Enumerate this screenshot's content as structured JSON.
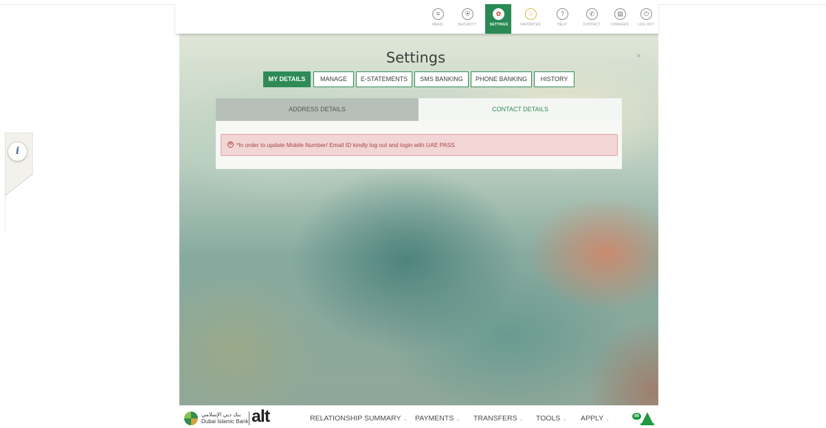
{
  "toolbar": {
    "items": [
      {
        "label": "MENU",
        "icon": "menu-icon",
        "glyph": "≡"
      },
      {
        "label": "SECURITY",
        "icon": "security-icon",
        "glyph": "⛨"
      },
      {
        "label": "SETTINGS",
        "icon": "settings-icon",
        "glyph": "✿"
      },
      {
        "label": "FAVORITES",
        "icon": "star-icon",
        "glyph": "☆"
      },
      {
        "label": "HELP",
        "icon": "help-icon",
        "glyph": "?"
      },
      {
        "label": "CONTACT",
        "icon": "phone-icon",
        "glyph": "✆"
      },
      {
        "label": "CHARGES",
        "icon": "charges-icon",
        "glyph": "▤"
      },
      {
        "label": "LOG OUT",
        "icon": "power-icon",
        "glyph": "⏻"
      }
    ],
    "active": "SETTINGS",
    "active_color": "#2a8a55"
  },
  "modal": {
    "title": "Settings",
    "close": "×",
    "tabs": [
      "MY DETAILS",
      "MANAGE",
      "E-STATEMENTS",
      "SMS BANKING",
      "PHONE BANKING",
      "HISTORY"
    ],
    "active_tab": "MY DETAILS",
    "subtabs": [
      "ADDRESS DETAILS",
      "CONTACT DETAILS"
    ],
    "active_subtab": "CONTACT DETAILS",
    "alert_icon": "⊗",
    "alert_text": "*In order to update Mobile Number/ Email ID kindly log out and login with UAE PASS"
  },
  "info_button": "i",
  "bottom_nav": {
    "logo_arabic": "بنك دبي الإسلامي",
    "logo_english": "Dubai Islamic Bank",
    "logo_brand": "alt",
    "items": [
      "RELATIONSHIP SUMMARY",
      "PAYMENTS",
      "TRANSFERS",
      "TOOLS",
      "APPLY"
    ],
    "caret": "⌄",
    "notification_badge": "00"
  },
  "colors": {
    "brand_green": "#2e8b57",
    "alert_bg": "#f2d5d5",
    "alert_text": "#a94442"
  }
}
